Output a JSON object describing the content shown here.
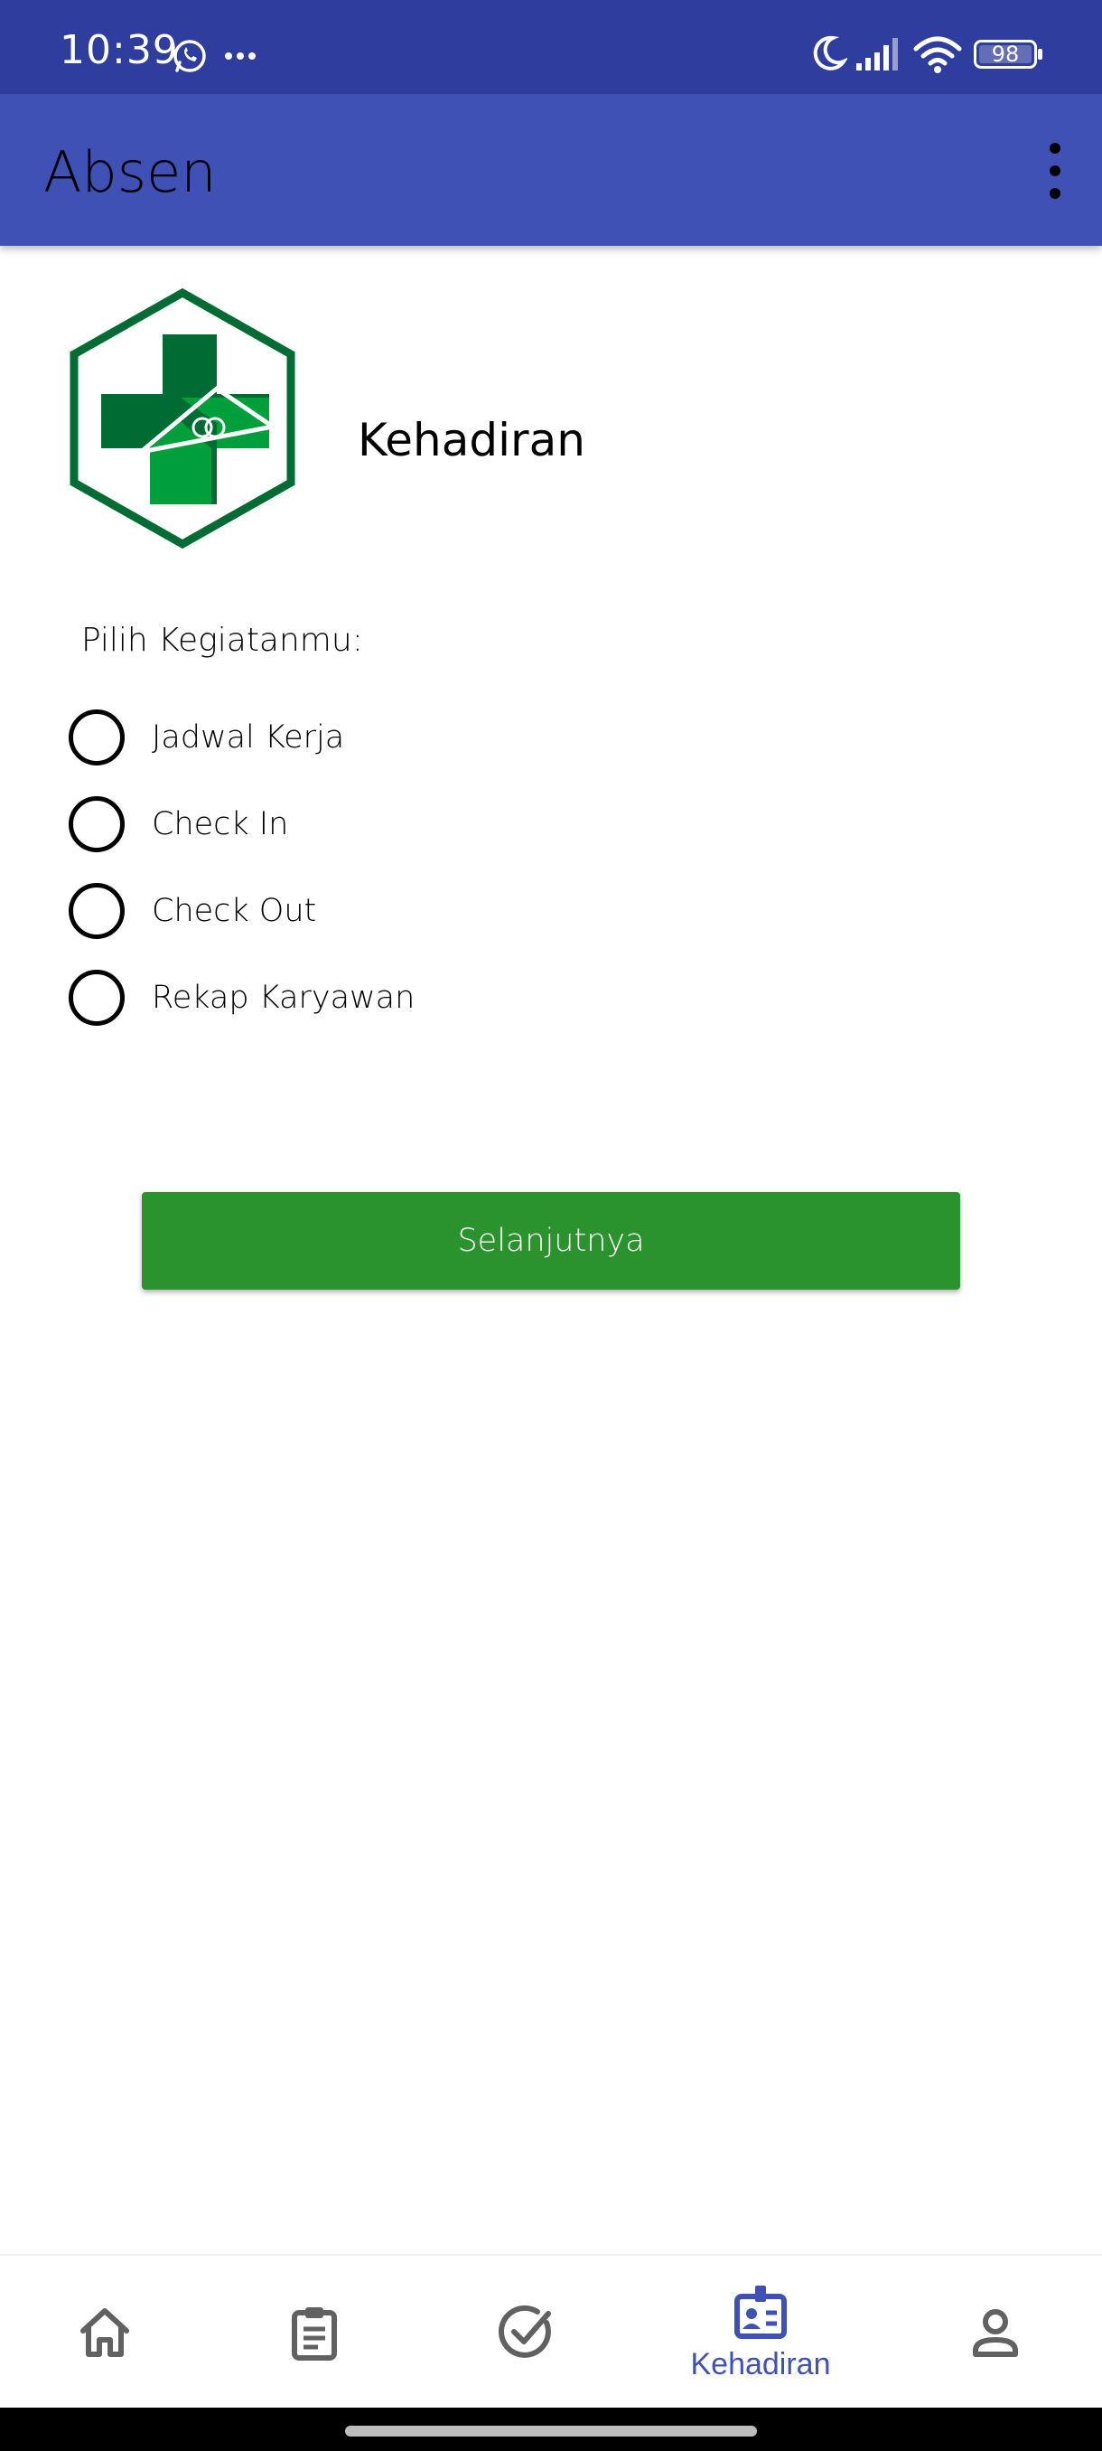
{
  "status_bar": {
    "time": "10:39",
    "battery": "98",
    "icons": [
      "whatsapp-icon",
      "more-dots-icon",
      "moon-icon",
      "signal-icon",
      "wifi-icon",
      "battery-icon"
    ]
  },
  "app_bar": {
    "title": "Absen",
    "menu_icon": "more-vert-icon"
  },
  "header": {
    "logo": "kemenkes-logo",
    "title": "Kehadiran"
  },
  "form": {
    "prompt": "Pilih Kegiatanmu:",
    "options": [
      {
        "label": "Jadwal Kerja",
        "selected": false
      },
      {
        "label": "Check In",
        "selected": false
      },
      {
        "label": "Check Out",
        "selected": false
      },
      {
        "label": "Rekap Karyawan",
        "selected": false
      }
    ],
    "next_label": "Selanjutnya"
  },
  "bottom_nav": {
    "items": [
      {
        "icon": "home-icon",
        "label": "",
        "active": false
      },
      {
        "icon": "clipboard-icon",
        "label": "",
        "active": false
      },
      {
        "icon": "check-circle-icon",
        "label": "",
        "active": false
      },
      {
        "icon": "badge-icon",
        "label": "Kehadiran",
        "active": true
      },
      {
        "icon": "person-icon",
        "label": "",
        "active": false
      }
    ]
  },
  "colors": {
    "status_bar": "#2f3e9e",
    "app_bar": "#3f51b5",
    "button": "#2a932d",
    "nav_active": "#3f51b5",
    "nav_inactive": "#616161",
    "logo_dark_green": "#006b33",
    "logo_light_green": "#009f3c"
  }
}
